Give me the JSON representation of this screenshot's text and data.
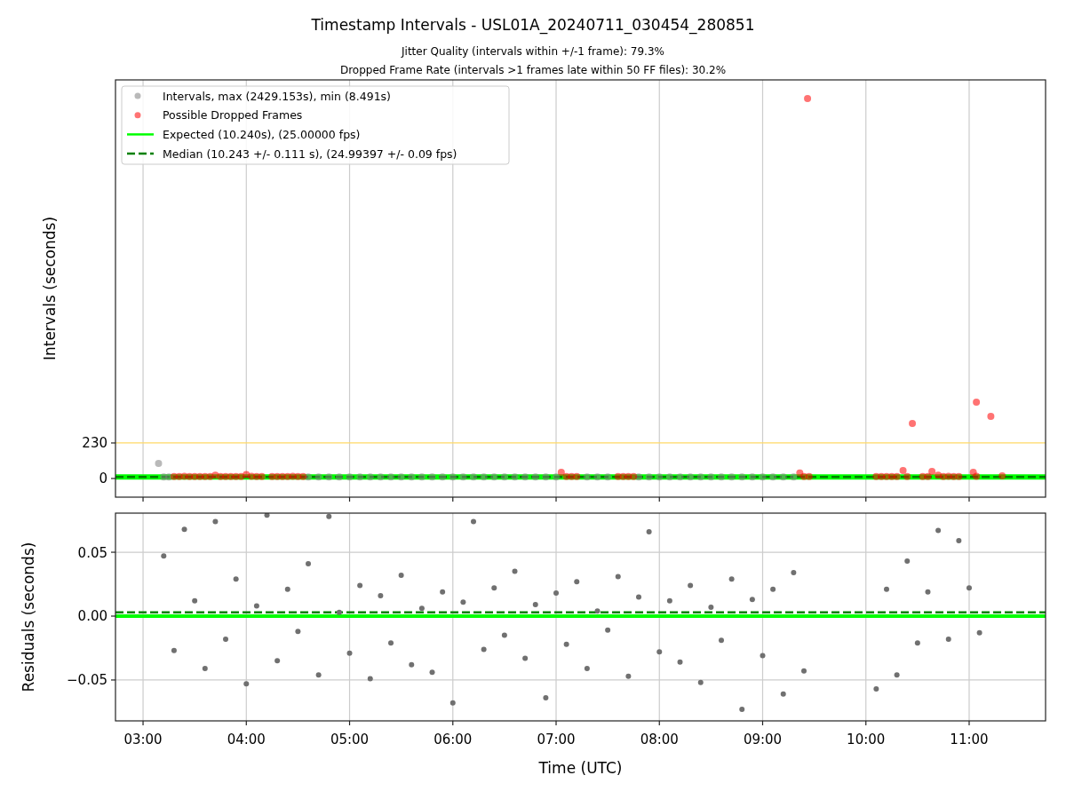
{
  "figure": {
    "title": "Timestamp Intervals - USL01A_20240711_030454_280851",
    "subtitles": [
      "Jitter Quality (intervals within +/-1 frame): 79.3%",
      "Dropped Frame Rate (intervals >1 frames late within 50 FF files): 30.2%"
    ]
  },
  "intervals_plot": {
    "chart_data": {
      "type": "scatter",
      "ylabel": "Intervals (seconds)",
      "xlim": [
        2.733,
        11.74
      ],
      "ylim": [
        -121,
        2582
      ],
      "yticks": [
        {
          "value": 0,
          "label": "0"
        },
        {
          "value": 230,
          "label": "230"
        }
      ],
      "grid": "x",
      "legend": true,
      "ref_lines": [
        {
          "axis": "y",
          "value": 230,
          "color": "#ffd966"
        },
        {
          "axis": "y",
          "value": 10.24,
          "color": "#00ff00",
          "label": "Expected (10.240s), (25.00000 fps)"
        },
        {
          "axis": "y",
          "value": 10.243,
          "color": "#008000",
          "label": "Median (10.243 +/- 0.111 s), (24.99397 +/- 0.09 fps)"
        }
      ],
      "series": [
        {
          "name": "Intervals, max (2429.153s), min (8.491s)",
          "color": "#808080",
          "x": [
            3.15,
            3.2,
            3.25,
            4.6,
            4.7,
            4.8,
            4.9,
            5.0,
            5.1,
            5.2,
            5.3,
            5.4,
            5.5,
            5.6,
            5.7,
            5.8,
            5.9,
            6.0,
            6.1,
            6.2,
            6.3,
            6.4,
            6.5,
            6.6,
            6.7,
            6.8,
            6.9,
            7.0,
            7.3,
            7.4,
            7.5,
            7.8,
            7.9,
            8.0,
            8.1,
            8.2,
            8.3,
            8.4,
            8.5,
            8.6,
            8.7,
            8.8,
            8.9,
            9.0,
            9.1,
            9.2,
            9.3
          ],
          "values": [
            98,
            10,
            10,
            10,
            10,
            10,
            10,
            10,
            10,
            10,
            10,
            10,
            10,
            10,
            10,
            10,
            10,
            10,
            10,
            10,
            10,
            10,
            10,
            10,
            10,
            10,
            10,
            10,
            10,
            10,
            10,
            10,
            10,
            10,
            10,
            10,
            10,
            10,
            10,
            10,
            10,
            10,
            10,
            10,
            10,
            10,
            10
          ]
        },
        {
          "name": "Possible Dropped Frames",
          "color": "#ff0000",
          "x": [
            3.3,
            3.35,
            3.4,
            3.45,
            3.5,
            3.55,
            3.6,
            3.65,
            3.7,
            3.75,
            3.8,
            3.85,
            3.9,
            3.95,
            4.0,
            4.05,
            4.1,
            4.15,
            4.25,
            4.3,
            4.35,
            4.4,
            4.45,
            4.5,
            4.55,
            7.05,
            7.1,
            7.15,
            7.2,
            7.6,
            7.65,
            7.7,
            7.75,
            9.36,
            9.4,
            9.435,
            9.45,
            10.1,
            10.15,
            10.2,
            10.25,
            10.3,
            10.36,
            10.4,
            10.45,
            10.55,
            10.6,
            10.64,
            10.7,
            10.75,
            10.8,
            10.85,
            10.9,
            11.04,
            11.07,
            11.07,
            11.21,
            11.32
          ],
          "values": [
            12,
            12,
            14,
            12,
            13,
            12,
            12,
            12,
            22,
            12,
            13,
            12,
            12,
            13,
            25,
            14,
            12,
            12,
            12,
            13,
            12,
            12,
            14,
            12,
            12,
            40,
            12,
            12,
            12,
            12,
            12,
            12,
            12,
            35,
            12,
            2461,
            12,
            12,
            12,
            12,
            12,
            12,
            52,
            12,
            356,
            12,
            12,
            46,
            22,
            12,
            14,
            12,
            12,
            40,
            494,
            14,
            402,
            17
          ]
        }
      ]
    }
  },
  "residuals_plot": {
    "chart_data": {
      "type": "scatter",
      "ylabel": "Residuals (seconds)",
      "xlabel": "Time (UTC)",
      "xlim": [
        2.733,
        11.74
      ],
      "ylim": [
        -0.082,
        0.0806
      ],
      "yticks": [
        {
          "value": -0.05,
          "label": "−0.05"
        },
        {
          "value": 0,
          "label": "0.00"
        },
        {
          "value": 0.05,
          "label": "0.05"
        }
      ],
      "xticks": [
        {
          "value": 3,
          "label": "03:00"
        },
        {
          "value": 4,
          "label": "04:00"
        },
        {
          "value": 5,
          "label": "05:00"
        },
        {
          "value": 6,
          "label": "06:00"
        },
        {
          "value": 7,
          "label": "07:00"
        },
        {
          "value": 8,
          "label": "08:00"
        },
        {
          "value": 9,
          "label": "09:00"
        },
        {
          "value": 10,
          "label": "10:00"
        },
        {
          "value": 11,
          "label": "11:00"
        }
      ],
      "grid": "both",
      "legend": false,
      "ref_lines": [
        {
          "axis": "y",
          "value": 0,
          "color": "#00ff00"
        },
        {
          "axis": "y",
          "value": 0.003,
          "color": "#008000"
        }
      ],
      "series": [
        {
          "color": "#707070",
          "x": [
            3.2,
            3.3,
            3.4,
            3.5,
            3.6,
            3.7,
            3.8,
            3.9,
            4.0,
            4.1,
            4.2,
            4.3,
            4.4,
            4.5,
            4.6,
            4.7,
            4.8,
            4.9,
            5.0,
            5.1,
            5.2,
            5.3,
            5.4,
            5.5,
            5.6,
            5.7,
            5.8,
            5.9,
            6.0,
            6.1,
            6.2,
            6.3,
            6.4,
            6.5,
            6.6,
            6.7,
            6.8,
            6.9,
            7.0,
            7.1,
            7.2,
            7.3,
            7.4,
            7.5,
            7.6,
            7.7,
            7.8,
            7.9,
            8.0,
            8.1,
            8.2,
            8.3,
            8.4,
            8.5,
            8.6,
            8.7,
            8.8,
            8.9,
            9.0,
            9.1,
            9.2,
            9.3,
            9.4,
            10.1,
            10.2,
            10.3,
            10.4,
            10.5,
            10.6,
            10.7,
            10.8,
            10.9,
            11.0,
            11.1
          ],
          "values": [
            0.047,
            -0.027,
            0.068,
            0.012,
            -0.041,
            0.074,
            -0.018,
            0.029,
            -0.053,
            0.008,
            0.079,
            -0.035,
            0.021,
            -0.012,
            0.041,
            -0.046,
            0.078,
            0.003,
            -0.029,
            0.024,
            -0.049,
            0.016,
            -0.021,
            0.032,
            -0.038,
            0.006,
            -0.044,
            0.019,
            -0.068,
            0.011,
            0.074,
            -0.026,
            0.022,
            -0.015,
            0.035,
            -0.033,
            0.009,
            -0.064,
            0.018,
            -0.022,
            0.027,
            -0.041,
            0.004,
            -0.011,
            0.031,
            -0.047,
            0.015,
            0.066,
            -0.028,
            0.012,
            -0.036,
            0.024,
            -0.052,
            0.007,
            -0.019,
            0.029,
            -0.073,
            0.013,
            -0.031,
            0.021,
            -0.061,
            0.034,
            -0.043,
            -0.057,
            0.021,
            -0.046,
            0.043,
            -0.021,
            0.019,
            0.067,
            -0.018,
            0.059,
            0.022,
            -0.013
          ]
        }
      ]
    }
  }
}
